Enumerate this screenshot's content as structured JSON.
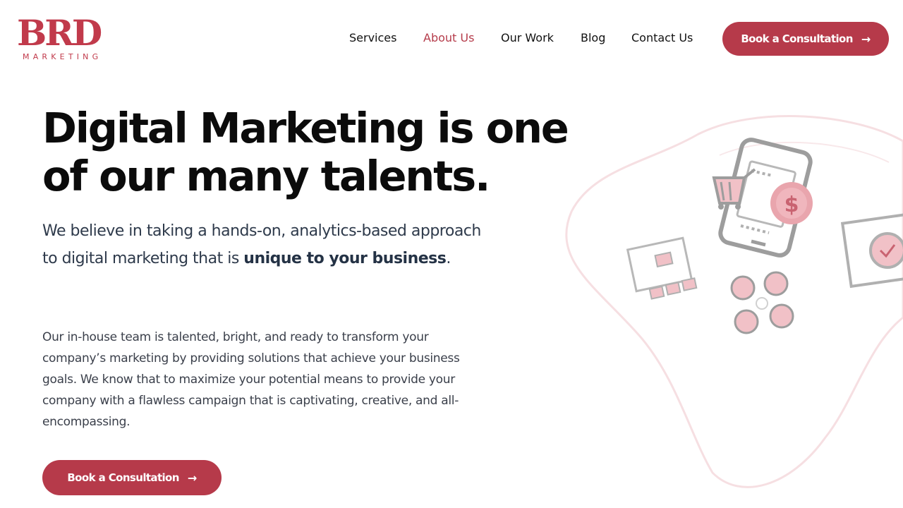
{
  "brand": {
    "logo_text": "BRD",
    "logo_subtext": "MARKETING",
    "accent_color": "#b63a4a"
  },
  "nav": {
    "items": [
      {
        "label": "Services",
        "active": false
      },
      {
        "label": "About Us",
        "active": true
      },
      {
        "label": "Our Work",
        "active": false
      },
      {
        "label": "Blog",
        "active": false
      },
      {
        "label": "Contact Us",
        "active": false
      }
    ]
  },
  "header_cta": {
    "label": "Book a Consultation",
    "icon": "arrow-right-icon"
  },
  "hero": {
    "headline_line1": "Digital Marketing is one",
    "headline_line2": "of our many talents.",
    "lead_prefix": "We believe in taking a hands-on, analytics-based approach to digital marketing that is ",
    "lead_bold": "unique to your business",
    "lead_suffix": ".",
    "body": "Our in-house team is talented, bright, and ready to transform your company’s marketing by providing solutions that achieve your business goals. We know that to maximize your potential means to provide your company with a flawless campaign that is captivating, creative, and all-encompassing.",
    "cta_label": "Book a Consultation",
    "cta_icon": "arrow-right-icon"
  },
  "illustration": {
    "icons": [
      "smartphone-icon",
      "shopping-cart-icon",
      "dollar-gear-icon",
      "sitemap-icon",
      "social-media-icon",
      "seo-check-icon"
    ]
  }
}
